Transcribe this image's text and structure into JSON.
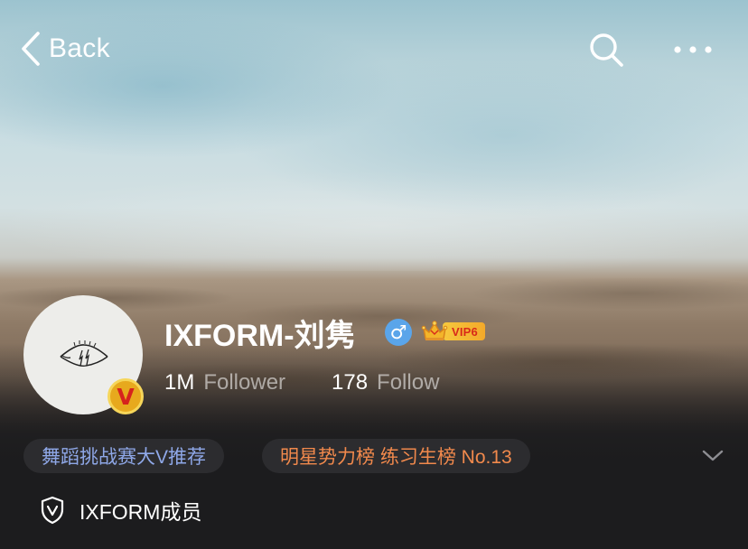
{
  "nav": {
    "back_label": "Back",
    "search_icon": "search-icon",
    "more_icon": "more-icon"
  },
  "profile": {
    "name": "IXFORM-刘隽",
    "gender_symbol": "♂",
    "verified_badge": "V",
    "vip_label": "VIP6",
    "followers_count": "1M",
    "followers_label": "Follower",
    "following_count": "178",
    "following_label": "Follow"
  },
  "tags": [
    {
      "label": "舞蹈挑战赛大V推荐",
      "color": "#8fa8e8"
    },
    {
      "label": "明星势力榜 练习生榜 No.13",
      "color": "#f1894c"
    }
  ],
  "member": {
    "label": "IXFORM成员",
    "icon": "shield-v-icon"
  },
  "colors": {
    "gender_badge": "#5aa5ea",
    "verified_badge": "#e7a91d",
    "vip_badge": "#f6c93e",
    "pill_bg": "#2c2c2f"
  }
}
